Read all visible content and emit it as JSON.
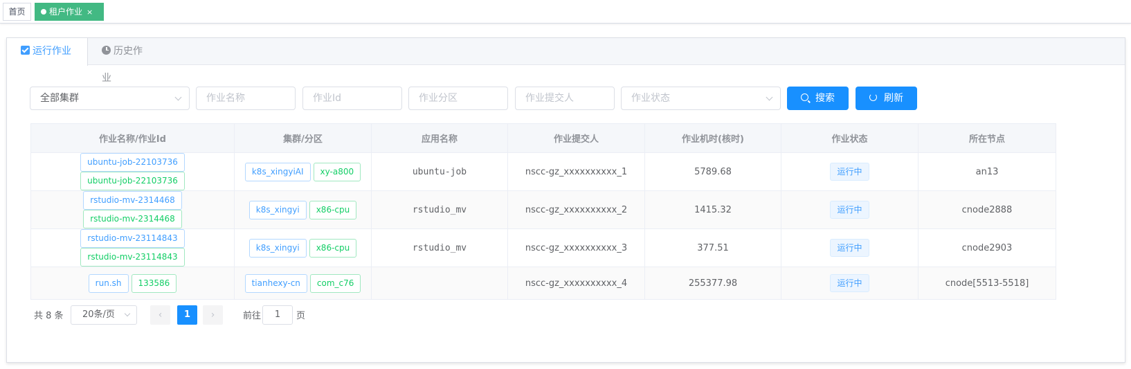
{
  "tags": {
    "home": "首页",
    "active": "租户作业",
    "close": "×"
  },
  "tabs": [
    {
      "label": "运行作业",
      "icon": "checkbox-icon"
    },
    {
      "label": "历史作业",
      "icon": "clock-icon"
    }
  ],
  "filters": {
    "cluster": "全部集群",
    "job_name_placeholder": "作业名称",
    "job_id_placeholder": "作业Id",
    "partition_placeholder": "作业分区",
    "submitter_placeholder": "作业提交人",
    "status_placeholder": "作业状态"
  },
  "buttons": {
    "search": "搜索",
    "refresh": "刷新"
  },
  "table": {
    "columns": [
      "作业名称/作业Id",
      "集群/分区",
      "应用名称",
      "作业提交人",
      "作业机时(核时)",
      "作业状态",
      "所在节点"
    ],
    "rows": [
      {
        "name": "ubuntu-job-22103736",
        "id": "ubuntu-job-22103736",
        "cluster": "k8s_xingyiAI",
        "partition": "xy-a800",
        "app": "ubuntu-job",
        "submitter": "nscc-gz_xxxxxxxxxx_1",
        "hours": "5789.68",
        "status": "运行中",
        "node": "an13"
      },
      {
        "name": "rstudio-mv-2314468",
        "id": "rstudio-mv-2314468",
        "cluster": "k8s_xingyi",
        "partition": "x86-cpu",
        "app": "rstudio_mv",
        "submitter": "nscc-gz_xxxxxxxxxx_2",
        "hours": "1415.32",
        "status": "运行中",
        "node": "cnode2888"
      },
      {
        "name": "rstudio-mv-23114843",
        "id": "rstudio-mv-23114843",
        "cluster": "k8s_xingyi",
        "partition": "x86-cpu",
        "app": "rstudio_mv",
        "submitter": "nscc-gz_xxxxxxxxxx_3",
        "hours": "377.51",
        "status": "运行中",
        "node": "cnode2903"
      },
      {
        "name": "run.sh",
        "id": "133586",
        "cluster": "tianhexy-cn",
        "partition": "com_c76",
        "app": "",
        "submitter": "nscc-gz_xxxxxxxxxx_4",
        "hours": "255377.98",
        "status": "运行中",
        "node": "cnode[5513-5518]"
      }
    ]
  },
  "pagination": {
    "total": "共 8 条",
    "page_size": "20条/页",
    "prev": "‹",
    "current": "1",
    "next": "›",
    "goto": "前往",
    "goto_value": "1",
    "page_suffix": "页"
  },
  "colors": {
    "primary": "#1890ff",
    "tag_active": "#42b983",
    "pill_blue": "#409eff",
    "pill_green": "#13ce66"
  }
}
